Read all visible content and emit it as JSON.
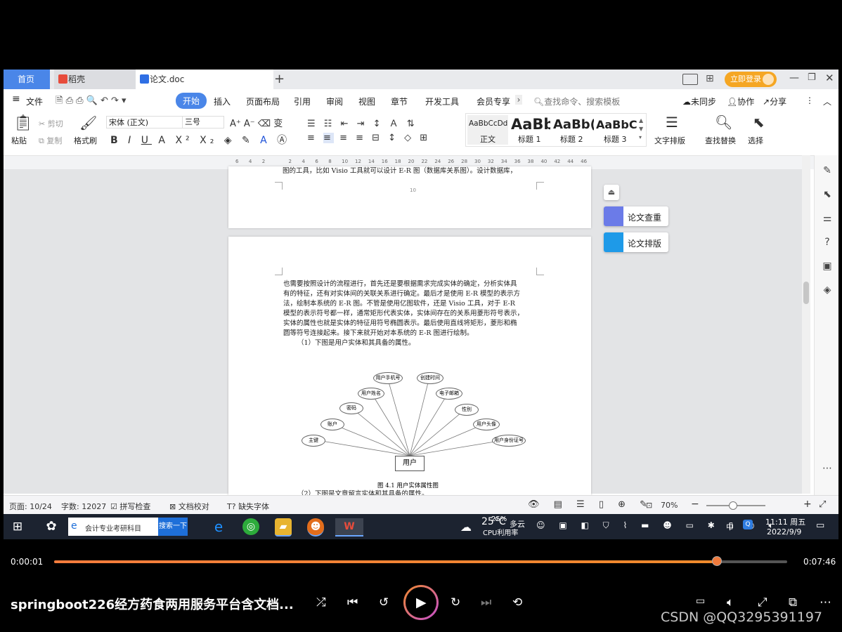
{
  "tabs": {
    "home": "首页",
    "daoke": "稻壳",
    "doc": "论文.doc",
    "new_tab": "+"
  },
  "window_controls": {
    "login": "立即登录"
  },
  "menu": {
    "file": "文件",
    "items": [
      "开始",
      "插入",
      "页面布局",
      "引用",
      "审阅",
      "视图",
      "章节",
      "开发工具",
      "会员专享"
    ],
    "search_placeholder": "查找命令、搜索模板",
    "sync": "未同步",
    "collab": "协作",
    "share": "分享"
  },
  "ribbon": {
    "paste": "粘贴",
    "cut": "剪切",
    "copy": "复制",
    "format_painter": "格式刷",
    "font_name": "宋体 (正文)",
    "font_size": "三号",
    "styles": [
      {
        "sample": "AaBbCcDd",
        "name": "正文"
      },
      {
        "sample": "AaBb",
        "name": "标题 1"
      },
      {
        "sample": "AaBb(",
        "name": "标题 2"
      },
      {
        "sample": "AaBbC(",
        "name": "标题 3"
      }
    ],
    "text_layout": "文字排版",
    "find_replace": "查找替换",
    "select": "选择"
  },
  "ruler": {
    "ticks": [
      "6",
      "4",
      "2",
      "",
      "2",
      "4",
      "6",
      "8",
      "10",
      "12",
      "14",
      "16",
      "18",
      "20",
      "22",
      "24",
      "26",
      "28",
      "30",
      "32",
      "34",
      "36",
      "38",
      "40",
      "42",
      "44",
      "46"
    ]
  },
  "document": {
    "top_page_line": "图的工具，比如 Visio 工具就可以设计 E-R 图（数据库关系图）。设计数据库，",
    "page_number": "10",
    "paragraph_lines": [
      "也需要按照设计的流程进行，首先还是要根据需求完成实体的确定，分析实体具",
      "有的特征，还有对实体间的关联关系进行确定。最后才是使用 E-R 模型的表示方",
      "法，绘制本系统的 E-R 图。不管是使用亿图软件，还是 Visio 工具，对于 E-R",
      "模型的表示符号都一样，通常矩形代表实体，实体间存在的关系用菱形符号表示，",
      "实体的属性也就是实体的特征用符号椭圆表示。最后使用直线将矩形，菱形和椭",
      "圆等符号连接起来。接下来就开始对本系统的 E-R 图进行绘制。",
      "（1）下图是用户实体和其具备的属性。"
    ],
    "er_entity": "用户",
    "er_attributes": [
      "主键",
      "账户",
      "密码",
      "用户姓名",
      "用户手机号",
      "创建时间",
      "电子邮箱",
      "性别",
      "用户头像",
      "用户身份证号"
    ],
    "figure_caption": "图 4.1 用户实体属性图",
    "next_line": "（2）下图是文章留言实体和其具备的属性。"
  },
  "float_buttons": {
    "check": "论文查重",
    "layout": "论文排版"
  },
  "status": {
    "page": "页面: 10/24",
    "words": "字数: 12027",
    "spell": "拼写检查",
    "proof": "文档校对",
    "missing_font": "缺失字体",
    "zoom": "70%"
  },
  "taskbar": {
    "search_text": "会计专业考研科目",
    "search_button": "搜索一下",
    "weather_temp": "25°C",
    "weather_desc": "多云",
    "cpu_percent": "25%",
    "cpu_label": "CPU利用率",
    "ime": "中",
    "time": "11:11 周五",
    "date": "2022/9/9"
  },
  "player": {
    "current_time": "0:00:01",
    "total_time": "0:07:46",
    "title": "springboot226经方药食两用服务平台含文档...",
    "progress": 0.904,
    "watermark": "CSDN @QQ3295391197"
  }
}
